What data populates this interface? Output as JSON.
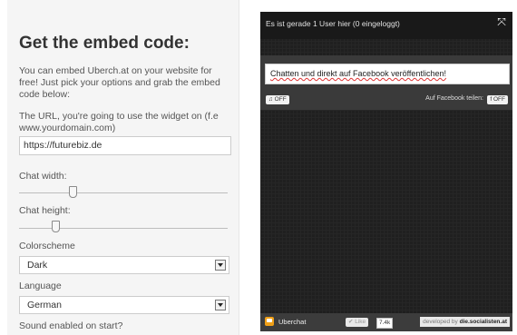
{
  "embed": {
    "title": "Get the embed code:",
    "intro": "You can embed Uberch.at on your website for free! Just pick your options and grab the embed code below:",
    "url_label": "The URL, you're going to use the widget on (f.e www.yourdomain.com)",
    "url_value": "https://futurebiz.de",
    "width_label": "Chat width:",
    "width_slider": 0.32,
    "height_label": "Chat height:",
    "height_slider": 0.2,
    "colorscheme_label": "Colorscheme",
    "colorscheme_value": "Dark",
    "language_label": "Language",
    "language_value": "German",
    "sound_label": "Sound enabled on start?"
  },
  "widget": {
    "status": "Es ist gerade 1 User hier (0 eingeloggt)",
    "input_placeholder": "Chatten und direkt auf Facebook veröffentlichen!",
    "sound_label": "♫ OFF",
    "fb_share_label": "Auf Facebook teilen:",
    "fb_toggle": "f OFF",
    "brand": "Uberchat",
    "like_label": "✔ Like",
    "like_count": "7.4k",
    "dev_prefix": "developed by",
    "dev_site": "die.socialisten.at"
  }
}
